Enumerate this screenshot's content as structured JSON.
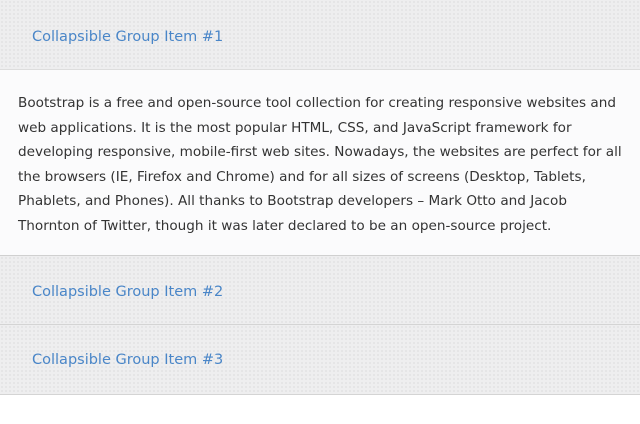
{
  "accordion": {
    "items": [
      {
        "title": "Collapsible Group Item #1",
        "expanded": true,
        "body": "Bootstrap is a free and open-source tool collection for creating responsive websites and web applications. It is the most popular HTML, CSS, and JavaScript framework for developing responsive, mobile-first web sites. Nowadays, the websites are perfect for all the browsers (IE, Firefox and Chrome) and for all sizes of screens (Desktop, Tablets, Phablets, and Phones). All thanks to Bootstrap developers – Mark Otto and Jacob Thornton of Twitter, though it was later declared to be an open-source project."
      },
      {
        "title": "Collapsible Group Item #2",
        "expanded": false
      },
      {
        "title": "Collapsible Group Item #3",
        "expanded": false
      }
    ]
  },
  "colors": {
    "link": "#4a86c8",
    "header_bg": "#eeeeef",
    "body_bg": "#fbfbfc",
    "text": "#333333"
  }
}
